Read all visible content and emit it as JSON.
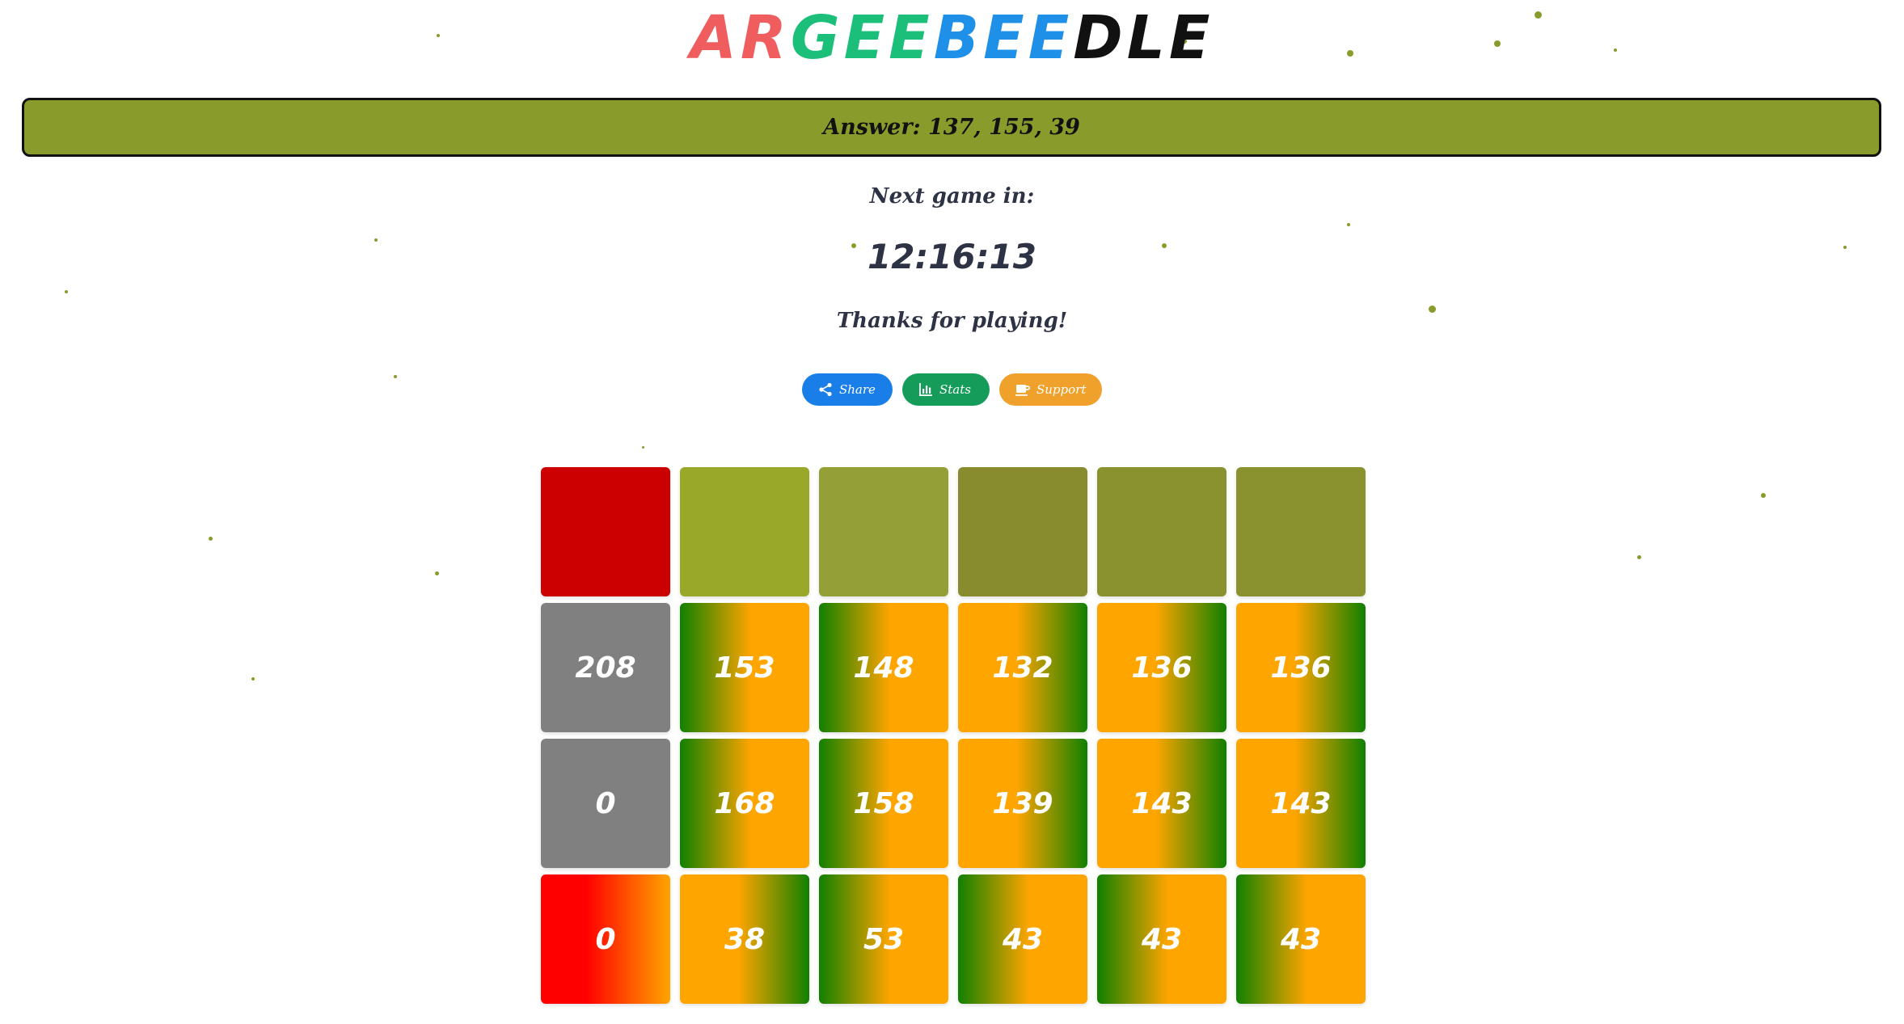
{
  "header": {
    "title_letters": [
      {
        "ch": "A",
        "color": "#f05d5e"
      },
      {
        "ch": "R",
        "color": "#f05d5e"
      },
      {
        "ch": "G",
        "color": "#1bbf7a"
      },
      {
        "ch": "E",
        "color": "#1bbf7a"
      },
      {
        "ch": "E",
        "color": "#1bbf7a"
      },
      {
        "ch": "B",
        "color": "#1e90e8"
      },
      {
        "ch": "E",
        "color": "#1e90e8"
      },
      {
        "ch": "E",
        "color": "#1e90e8"
      },
      {
        "ch": "D",
        "color": "#111111"
      },
      {
        "ch": "L",
        "color": "#111111"
      },
      {
        "ch": "E",
        "color": "#111111"
      }
    ]
  },
  "banner": {
    "answer_text": "Answer: 137, 155, 39",
    "color": "#889b2b"
  },
  "status": {
    "next_game_label": "Next game in:",
    "countdown": "12:16:13",
    "thanks": "Thanks for playing!"
  },
  "buttons": {
    "share": {
      "label": "Share",
      "icon": "share-icon"
    },
    "stats": {
      "label": "Stats",
      "icon": "bar-chart-icon"
    },
    "support": {
      "label": "Support",
      "icon": "coffee-cup-icon"
    }
  },
  "board": {
    "guess_colors": [
      "#cc0000",
      "#9aa82a",
      "#959f38",
      "#888c2e",
      "#8a912f",
      "#8a912f"
    ],
    "rows": [
      {
        "channel": "red",
        "tiles": [
          {
            "value": "208",
            "fill": "gray"
          },
          {
            "value": "153",
            "fill": "green-to-orange"
          },
          {
            "value": "148",
            "fill": "green-to-orange"
          },
          {
            "value": "132",
            "fill": "orange-to-green"
          },
          {
            "value": "136",
            "fill": "orange-to-green"
          },
          {
            "value": "136",
            "fill": "orange-to-green"
          }
        ]
      },
      {
        "channel": "green",
        "tiles": [
          {
            "value": "0",
            "fill": "gray"
          },
          {
            "value": "168",
            "fill": "green-to-orange"
          },
          {
            "value": "158",
            "fill": "green-to-orange"
          },
          {
            "value": "139",
            "fill": "orange-to-green"
          },
          {
            "value": "143",
            "fill": "orange-to-green"
          },
          {
            "value": "143",
            "fill": "orange-to-green"
          }
        ]
      },
      {
        "channel": "blue",
        "tiles": [
          {
            "value": "0",
            "fill": "red-to-orange"
          },
          {
            "value": "38",
            "fill": "orange-to-green"
          },
          {
            "value": "53",
            "fill": "green-to-orange"
          },
          {
            "value": "43",
            "fill": "green-to-orange"
          },
          {
            "value": "43",
            "fill": "green-to-orange"
          },
          {
            "value": "43",
            "fill": "green-to-orange"
          }
        ]
      }
    ],
    "fill_colors": {
      "gray": "#808080",
      "green": "#118000",
      "orange": "#ffa500",
      "red": "#ff0000"
    }
  }
}
